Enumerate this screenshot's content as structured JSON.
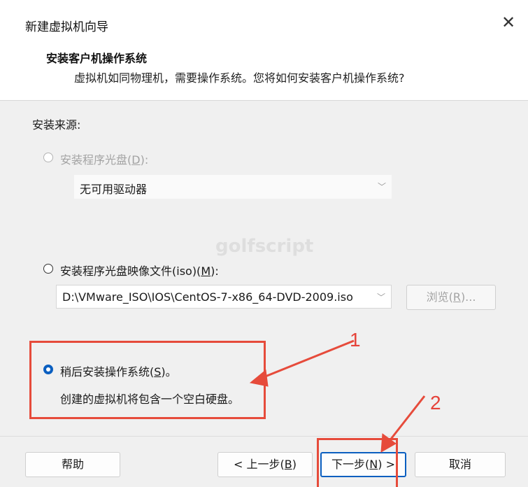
{
  "window": {
    "title": "新建虚拟机向导",
    "close_glyph": "✕"
  },
  "header": {
    "title": "安装客户机操作系统",
    "subtitle": "虚拟机如同物理机，需要操作系统。您将如何安装客户机操作系统?"
  },
  "install_source": {
    "label": "安装来源:",
    "disc_option": {
      "label_prefix": "安装程序光盘(",
      "accel": "D",
      "label_suffix": "):",
      "selected": false,
      "enabled": false
    },
    "disc_drive": {
      "value": "无可用驱动器",
      "enabled": false
    },
    "iso_option": {
      "label_prefix": "安装程序光盘映像文件(iso)(",
      "accel": "M",
      "label_suffix": "):",
      "selected": false,
      "enabled": true
    },
    "iso_path": {
      "value": "D:\\VMware_ISO\\IOS\\CentOS-7-x86_64-DVD-2009.iso",
      "enabled": true
    },
    "browse_button": {
      "label_prefix": "浏览(",
      "accel": "R",
      "label_suffix": ")...",
      "enabled": false
    },
    "later_option": {
      "label_prefix": "稍后安装操作系统(",
      "accel": "S",
      "label_suffix": ")。",
      "selected": true,
      "enabled": true
    },
    "later_description": "创建的虚拟机将包含一个空白硬盘。"
  },
  "watermark": "golfscript",
  "footer": {
    "help_label": "帮助",
    "back_prefix": "< 上一步(",
    "back_accel": "B",
    "back_suffix": ")",
    "next_prefix": "下一步(",
    "next_accel": "N",
    "next_suffix": ") >",
    "cancel_label": "取消"
  },
  "annotations": {
    "labels": [
      "1",
      "2"
    ],
    "color": "#e64b3b"
  },
  "colors": {
    "accent": "#0b5fc0",
    "annotation": "#e64b3b"
  }
}
